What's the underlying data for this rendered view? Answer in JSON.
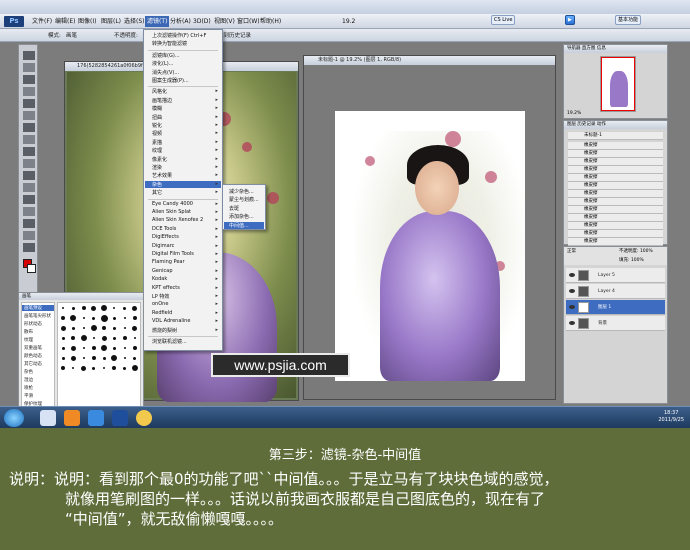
{
  "menubar": {
    "items": [
      "文件(F)",
      "编辑(E)",
      "图像(I)",
      "图层(L)",
      "选择(S)",
      "滤镜(T)",
      "分析(A)",
      "3D(D)",
      "视图(V)",
      "窗口(W)",
      "帮助(H)"
    ],
    "active_index": 5,
    "zoom": "19.2",
    "topright": {
      "cs_live": "CS Live",
      "mode": "基本功能"
    }
  },
  "options": {
    "label": "模式:",
    "mode": "画笔",
    "opacity_label": "不透明度:",
    "record": "抹到历史记录"
  },
  "doc1": {
    "title": "176(5282854261a0f06b9f5)_jpg @ 66.7% (RGB/8)"
  },
  "doc2": {
    "title": "未标题-1 @ 19.2% (图层 1, RGB/8)"
  },
  "filter_menu": {
    "items": [
      {
        "label": "上次滤镜操作(F)  Ctrl+F",
        "arrow": false
      },
      {
        "label": "转换为智能滤镜",
        "arrow": false
      },
      {
        "label": "滤镜库(G)...",
        "arrow": false
      },
      {
        "label": "液化(L)...",
        "arrow": false
      },
      {
        "label": "消失点(V)...",
        "arrow": false
      },
      {
        "label": "图案生成器(P)...",
        "arrow": false
      },
      {
        "label": "风格化",
        "arrow": true
      },
      {
        "label": "画笔描边",
        "arrow": true
      },
      {
        "label": "模糊",
        "arrow": true
      },
      {
        "label": "扭曲",
        "arrow": true
      },
      {
        "label": "锐化",
        "arrow": true
      },
      {
        "label": "视频",
        "arrow": true
      },
      {
        "label": "素描",
        "arrow": true
      },
      {
        "label": "纹理",
        "arrow": true
      },
      {
        "label": "像素化",
        "arrow": true
      },
      {
        "label": "渲染",
        "arrow": true
      },
      {
        "label": "艺术效果",
        "arrow": true
      },
      {
        "label": "杂色",
        "arrow": true
      },
      {
        "label": "其它",
        "arrow": true
      },
      {
        "label": "Eye Candy 4000",
        "arrow": true
      },
      {
        "label": "Alien Skin Splat",
        "arrow": true
      },
      {
        "label": "Alien Skin Xenofex 2",
        "arrow": true
      },
      {
        "label": "DCE Tools",
        "arrow": true
      },
      {
        "label": "DigiEffects",
        "arrow": true
      },
      {
        "label": "Digimarc",
        "arrow": true
      },
      {
        "label": "Digital Film Tools",
        "arrow": true
      },
      {
        "label": "Flaming Pear",
        "arrow": true
      },
      {
        "label": "Genicap",
        "arrow": true
      },
      {
        "label": "Kodak",
        "arrow": true
      },
      {
        "label": "KPT effects",
        "arrow": true
      },
      {
        "label": "LP 特效",
        "arrow": true
      },
      {
        "label": "onOne",
        "arrow": true
      },
      {
        "label": "Redfield",
        "arrow": true
      },
      {
        "label": "VDL Adrenaline",
        "arrow": true
      },
      {
        "label": "燃烧的梨树",
        "arrow": true
      },
      {
        "label": "浏览联机滤镜...",
        "arrow": false
      }
    ],
    "highlight_index": 17
  },
  "noise_submenu": {
    "items": [
      "减少杂色...",
      "蒙尘与划痕...",
      "去斑",
      "添加杂色...",
      "中间值..."
    ],
    "highlight_index": 4
  },
  "brush_panel": {
    "tab": "画笔",
    "presets": [
      "画笔预设",
      "画笔笔尖形状",
      "形状动态",
      "散布",
      "纹理",
      "双重画笔",
      "颜色动态",
      "其它动态",
      "杂色",
      "湿边",
      "喷枪",
      "平滑",
      "保护纹理"
    ],
    "selected_index": 0
  },
  "watermark": "www.psjia.com",
  "nav_panel": {
    "tabs": "导航器   直方图   信息",
    "zoom": "19.2%"
  },
  "history_panel": {
    "tabs": "图层   历史记录   动作",
    "doc": "未标题-1",
    "rows": [
      "橡皮擦",
      "橡皮擦",
      "橡皮擦",
      "橡皮擦",
      "橡皮擦",
      "橡皮擦",
      "橡皮擦",
      "橡皮擦",
      "橡皮擦",
      "橡皮擦",
      "橡皮擦",
      "橡皮擦",
      "橡皮擦"
    ]
  },
  "layers_panel": {
    "mode": "正常",
    "opacity": "不透明度: 100%",
    "fill": "填充: 100%",
    "layers": [
      "Layer 5",
      "Layer 4",
      "图层 1",
      "背景"
    ],
    "selected_index": 2
  },
  "taskbar": {
    "time": "18:37",
    "date": "2011/9/25"
  },
  "caption": {
    "title": "第三步：滤镜-杂色-中间值",
    "line1": "说明：说明：看到那个最0的功能了吧``中间值。。。于是立马有了块块色域的感觉，",
    "line2": "就像用笔刷图的一样。。。话说以前我画衣服都是自己图底色的，现在有了",
    "line3": "“中间值”，就无敌偷懒嘎嘎。。。。"
  },
  "colors": {
    "caption_bg": "#5f6d3b",
    "menu_highlight": "#3d6cc0",
    "workspace": "#7c7c7c"
  }
}
